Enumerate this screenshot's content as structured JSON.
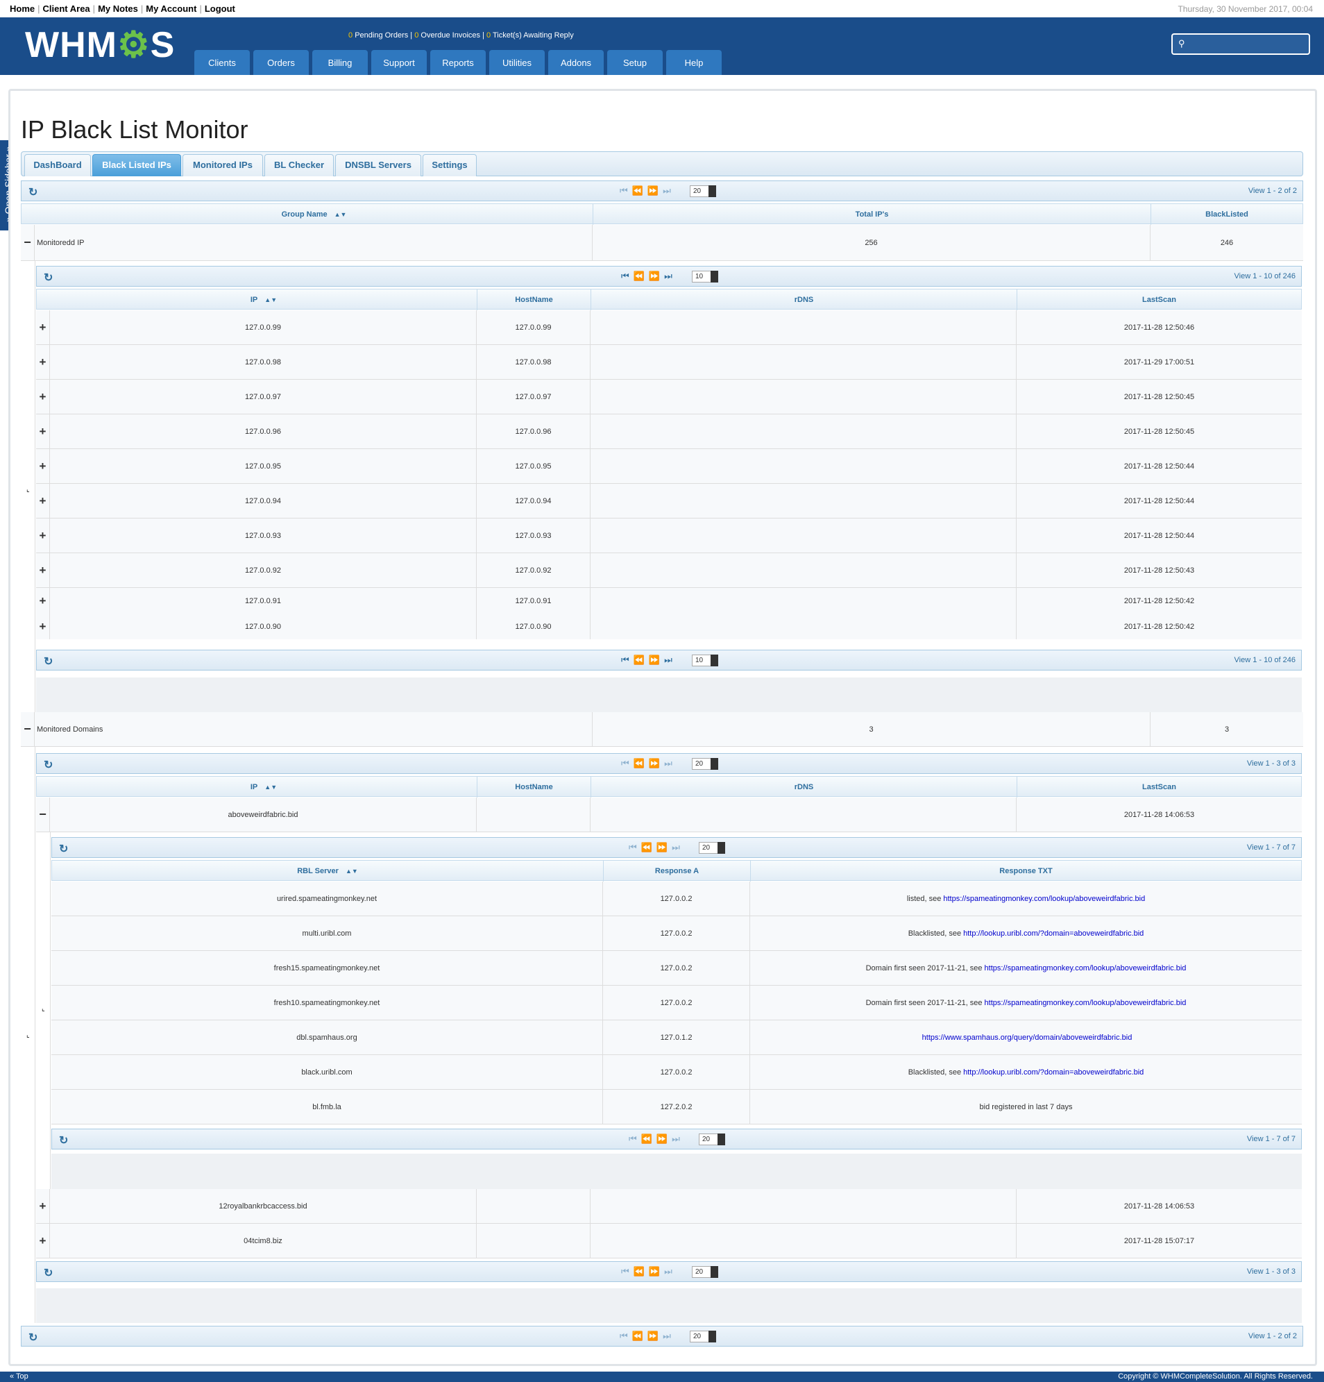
{
  "topbar": {
    "links": [
      "Home",
      "Client Area",
      "My Notes",
      "My Account",
      "Logout"
    ],
    "date": "Thursday, 30 November 2017, 00:04"
  },
  "header": {
    "logo": "WHMCS",
    "alerts": {
      "pending_count": "0",
      "pending_label": "Pending Orders",
      "overdue_count": "0",
      "overdue_label": "Overdue Invoices",
      "tickets_count": "0",
      "tickets_label": "Ticket(s) Awaiting Reply"
    },
    "nav": [
      "Clients",
      "Orders",
      "Billing",
      "Support",
      "Reports",
      "Utilities",
      "Addons",
      "Setup",
      "Help"
    ]
  },
  "sidebar": {
    "label": "» Open Sidebar »"
  },
  "page": {
    "title": "IP Black List Monitor",
    "tabs": [
      "DashBoard",
      "Black Listed IPs",
      "Monitored IPs",
      "BL Checker",
      "DNSBL Servers",
      "Settings"
    ],
    "active_tab": "Black Listed IPs"
  },
  "outer": {
    "page_size": "20",
    "view": "View 1 - 2 of 2",
    "headers": [
      "Group Name",
      "Total IP's",
      "BlackListed"
    ]
  },
  "groups": [
    {
      "name": "Monitoredd IP",
      "total": "256",
      "blacklisted": "246",
      "page_size": "10",
      "view": "View 1 - 10 of 246",
      "headers": [
        "IP",
        "HostName",
        "rDNS",
        "LastScan"
      ],
      "rows": [
        {
          "ip": "127.0.0.99",
          "host": "127.0.0.99",
          "rdns": "",
          "scan": "2017-11-28 12:50:46"
        },
        {
          "ip": "127.0.0.98",
          "host": "127.0.0.98",
          "rdns": "",
          "scan": "2017-11-29 17:00:51"
        },
        {
          "ip": "127.0.0.97",
          "host": "127.0.0.97",
          "rdns": "",
          "scan": "2017-11-28 12:50:45"
        },
        {
          "ip": "127.0.0.96",
          "host": "127.0.0.96",
          "rdns": "",
          "scan": "2017-11-28 12:50:45"
        },
        {
          "ip": "127.0.0.95",
          "host": "127.0.0.95",
          "rdns": "",
          "scan": "2017-11-28 12:50:44"
        },
        {
          "ip": "127.0.0.94",
          "host": "127.0.0.94",
          "rdns": "",
          "scan": "2017-11-28 12:50:44"
        },
        {
          "ip": "127.0.0.93",
          "host": "127.0.0.93",
          "rdns": "",
          "scan": "2017-11-28 12:50:44"
        },
        {
          "ip": "127.0.0.92",
          "host": "127.0.0.92",
          "rdns": "",
          "scan": "2017-11-28 12:50:43"
        },
        {
          "ip": "127.0.0.91",
          "host": "127.0.0.91",
          "rdns": "",
          "scan": "2017-11-28 12:50:42"
        },
        {
          "ip": "127.0.0.90",
          "host": "127.0.0.90",
          "rdns": "",
          "scan": "2017-11-28 12:50:42"
        }
      ]
    },
    {
      "name": "Monitored Domains",
      "total": "3",
      "blacklisted": "3",
      "page_size": "20",
      "view": "View 1 - 3 of 3",
      "headers": [
        "IP",
        "HostName",
        "rDNS",
        "LastScan"
      ],
      "rows": [
        {
          "ip": "aboveweirdfabric.bid",
          "host": "",
          "rdns": "",
          "scan": "2017-11-28 14:06:53"
        },
        {
          "ip": "12royalbankrbcaccess.bid",
          "host": "",
          "rdns": "",
          "scan": "2017-11-28 14:06:53"
        },
        {
          "ip": "04tcim8.biz",
          "host": "",
          "rdns": "",
          "scan": "2017-11-28 15:07:17"
        }
      ],
      "detail": {
        "page_size": "20",
        "view": "View 1 - 7 of 7",
        "headers": [
          "RBL Server",
          "Response A",
          "Response TXT"
        ],
        "rows": [
          {
            "server": "urired.spameatingmonkey.net",
            "a": "127.0.0.2",
            "txt": "listed, see ",
            "link": "https://spameatingmonkey.com/lookup/aboveweirdfabric.bid"
          },
          {
            "server": "multi.uribl.com",
            "a": "127.0.0.2",
            "txt": "Blacklisted, see ",
            "link": "http://lookup.uribl.com/?domain=aboveweirdfabric.bid"
          },
          {
            "server": "fresh15.spameatingmonkey.net",
            "a": "127.0.0.2",
            "txt": "Domain first seen 2017-11-21, see ",
            "link": "https://spameatingmonkey.com/lookup/aboveweirdfabric.bid"
          },
          {
            "server": "fresh10.spameatingmonkey.net",
            "a": "127.0.0.2",
            "txt": "Domain first seen 2017-11-21, see ",
            "link": "https://spameatingmonkey.com/lookup/aboveweirdfabric.bid"
          },
          {
            "server": "dbl.spamhaus.org",
            "a": "127.0.1.2",
            "txt": "",
            "link": "https://www.spamhaus.org/query/domain/aboveweirdfabric.bid"
          },
          {
            "server": "black.uribl.com",
            "a": "127.0.0.2",
            "txt": "Blacklisted, see ",
            "link": "http://lookup.uribl.com/?domain=aboveweirdfabric.bid"
          },
          {
            "server": "bl.fmb.la",
            "a": "127.2.0.2",
            "txt": "bid registered in last 7 days",
            "link": ""
          }
        ]
      }
    }
  ],
  "footer": {
    "top": "« Top",
    "copyright": "Copyright © WHMCompleteSolution. All Rights Reserved."
  }
}
